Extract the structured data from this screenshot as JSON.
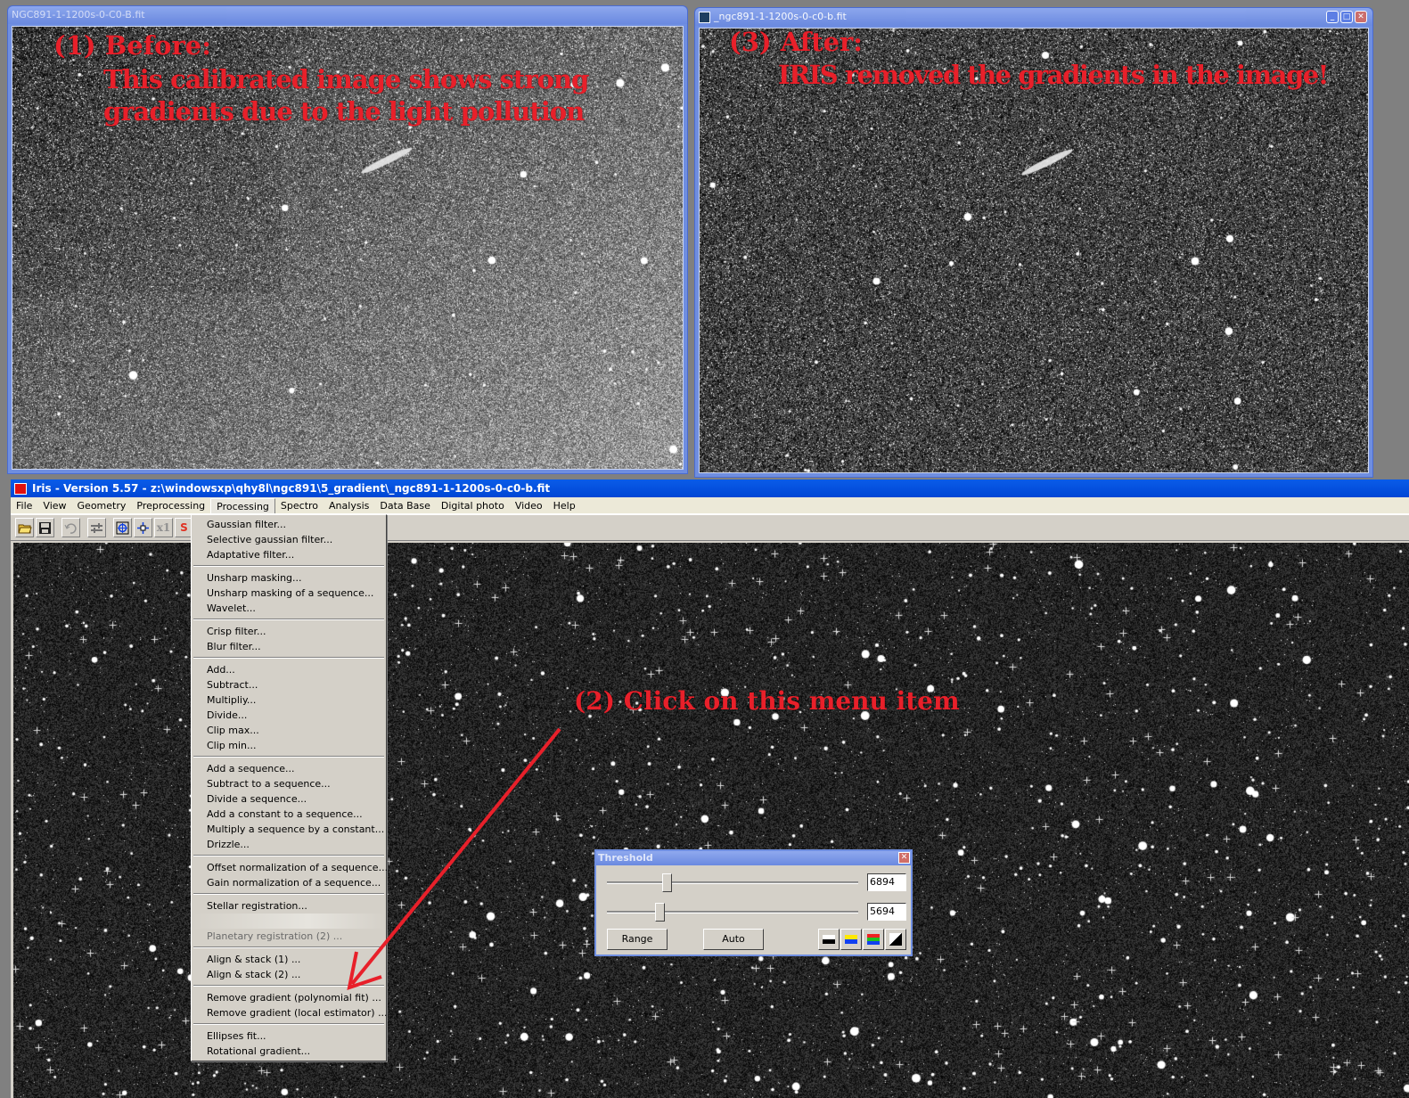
{
  "before_window": {
    "title": "NGC891-1-1200s-0-C0-B.fit",
    "annotation_heading": "(1) Before:",
    "annotation_line1": "This calibrated image shows strong",
    "annotation_line2": "gradients due to the light pollution"
  },
  "after_window": {
    "title": "_ngc891-1-1200s-0-c0-b.fit",
    "annotation_heading": "(3) After:",
    "annotation_line1": "IRIS removed the gradients in the image!",
    "buttons": {
      "minimize": "_",
      "maximize": "□",
      "close": "✕"
    }
  },
  "main_window": {
    "title": "Iris - Version 5.57 - z:\\windowsxp\\qhy8l\\ngc891\\5_gradient\\_ngc891-1-1200s-0-c0-b.fit",
    "menu": [
      "File",
      "View",
      "Geometry",
      "Preprocessing",
      "Processing",
      "Spectro",
      "Analysis",
      "Data Base",
      "Digital photo",
      "Video",
      "Help"
    ],
    "active_menu": "Processing",
    "toolbar": [
      {
        "icon": "open-folder-icon"
      },
      {
        "icon": "save-disk-icon"
      },
      {
        "icon": "undo-icon"
      },
      {
        "icon": "threshold-sliders-icon"
      },
      {
        "icon": "zoom-fit-icon"
      },
      {
        "icon": "center-move-icon"
      },
      {
        "label": "x1",
        "icon": "zoom-1x-icon"
      }
    ]
  },
  "processing_menu": {
    "groups": [
      [
        "Gaussian filter...",
        "Selective gaussian filter...",
        "Adaptative filter..."
      ],
      [
        "Unsharp masking...",
        "Unsharp masking of a sequence...",
        "Wavelet..."
      ],
      [
        "Crisp filter...",
        "Blur filter..."
      ],
      [
        "Add...",
        "Subtract...",
        "Multipliy...",
        "Divide...",
        "Clip max...",
        "Clip min..."
      ],
      [
        "Add a sequence...",
        "Subtract to a sequence...",
        "Divide a sequence...",
        "Add a constant to a sequence...",
        "Multiply a sequence by a constant...",
        "Drizzle..."
      ],
      [
        "Offset normalization of a sequence...",
        "Gain normalization of a sequence..."
      ],
      [
        "Stellar registration...",
        "",
        "Planetary registration (2) ..."
      ],
      [
        "Align & stack (1) ...",
        "Align & stack (2) ..."
      ],
      [
        "Remove gradient (polynomial fit) ...",
        "Remove gradient (local estimator) ..."
      ],
      [
        "Ellipses fit...",
        "Rotational gradient..."
      ]
    ],
    "target_item": "Remove gradient (polynomial fit) ..."
  },
  "click_annotation": "(2) Click on this menu item",
  "annotation_color": "#e8202a",
  "threshold_dialog": {
    "title": "Threshold",
    "high_value": "6894",
    "low_value": "5694",
    "high_slider_fraction": 0.22,
    "low_slider_fraction": 0.19,
    "range_label": "Range",
    "auto_label": "Auto",
    "palette_buttons": [
      "grayscale-palette-icon",
      "yellow-blue-palette-icon",
      "rgb-palette-icon",
      "invert-palette-icon"
    ]
  }
}
